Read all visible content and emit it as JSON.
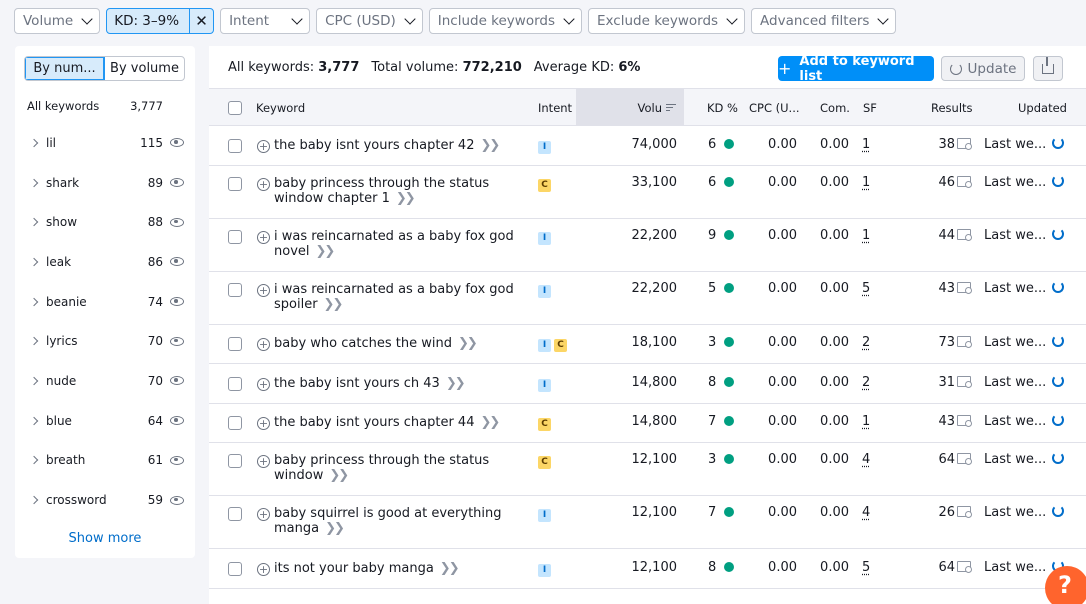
{
  "filters": [
    {
      "label": "Volume"
    },
    {
      "label": "KD: 3–9%",
      "active": true
    },
    {
      "label": "Intent"
    },
    {
      "label": "CPC (USD)"
    },
    {
      "label": "Include keywords"
    },
    {
      "label": "Exclude keywords"
    },
    {
      "label": "Advanced filters"
    }
  ],
  "sidebar": {
    "toggle": [
      "By num...",
      "By volume"
    ],
    "header_label": "All keywords",
    "header_count": "3,777",
    "items": [
      {
        "word": "lil",
        "count": "115"
      },
      {
        "word": "shark",
        "count": "89"
      },
      {
        "word": "show",
        "count": "88"
      },
      {
        "word": "leak",
        "count": "86"
      },
      {
        "word": "beanie",
        "count": "74"
      },
      {
        "word": "lyrics",
        "count": "70"
      },
      {
        "word": "nude",
        "count": "70"
      },
      {
        "word": "blue",
        "count": "64"
      },
      {
        "word": "breath",
        "count": "61"
      },
      {
        "word": "crossword",
        "count": "59"
      }
    ],
    "show_more": "Show more"
  },
  "summary": {
    "all_label": "All keywords:",
    "all_value": "3,777",
    "vol_label": "Total volume:",
    "vol_value": "772,210",
    "kd_label": "Average KD:",
    "kd_value": "6%"
  },
  "buttons": {
    "add": "Add to keyword list",
    "update": "Update"
  },
  "columns": {
    "keyword": "Keyword",
    "intent": "Intent",
    "volume": "Volu",
    "kd": "KD %",
    "cpc": "CPC (U...",
    "com": "Com.",
    "sf": "SF",
    "results": "Results",
    "updated": "Updated"
  },
  "rows": [
    {
      "kw1": "the baby isnt yours chapter 42",
      "kw2": "",
      "intent": [
        "I"
      ],
      "volume": "74,000",
      "kd": "6",
      "cpc": "0.00",
      "com": "0.00",
      "sf": "1",
      "results": "38",
      "updated": "Last we..."
    },
    {
      "kw1": "baby princess through the status",
      "kw2": "window chapter 1",
      "intent": [
        "C"
      ],
      "volume": "33,100",
      "kd": "6",
      "cpc": "0.00",
      "com": "0.00",
      "sf": "1",
      "results": "46",
      "updated": "Last we..."
    },
    {
      "kw1": "i was reincarnated as a baby fox god",
      "kw2": "novel",
      "intent": [
        "I"
      ],
      "volume": "22,200",
      "kd": "9",
      "cpc": "0.00",
      "com": "0.00",
      "sf": "1",
      "results": "44",
      "updated": "Last we..."
    },
    {
      "kw1": "i was reincarnated as a baby fox god",
      "kw2": "spoiler",
      "intent": [
        "I"
      ],
      "volume": "22,200",
      "kd": "5",
      "cpc": "0.00",
      "com": "0.00",
      "sf": "5",
      "results": "43",
      "updated": "Last we..."
    },
    {
      "kw1": "baby who catches the wind",
      "kw2": "",
      "intent": [
        "I",
        "C"
      ],
      "volume": "18,100",
      "kd": "3",
      "cpc": "0.00",
      "com": "0.00",
      "sf": "2",
      "results": "73",
      "updated": "Last we..."
    },
    {
      "kw1": "the baby isnt yours ch 43",
      "kw2": "",
      "intent": [
        "I"
      ],
      "volume": "14,800",
      "kd": "8",
      "cpc": "0.00",
      "com": "0.00",
      "sf": "2",
      "results": "31",
      "updated": "Last we..."
    },
    {
      "kw1": "the baby isnt yours chapter 44",
      "kw2": "",
      "intent": [
        "C"
      ],
      "volume": "14,800",
      "kd": "7",
      "cpc": "0.00",
      "com": "0.00",
      "sf": "1",
      "results": "43",
      "updated": "Last we..."
    },
    {
      "kw1": "baby princess through the status",
      "kw2": "window",
      "intent": [
        "C"
      ],
      "volume": "12,100",
      "kd": "3",
      "cpc": "0.00",
      "com": "0.00",
      "sf": "4",
      "results": "64",
      "updated": "Last we..."
    },
    {
      "kw1": "baby squirrel is good at everything",
      "kw2": "manga",
      "intent": [
        "I"
      ],
      "volume": "12,100",
      "kd": "7",
      "cpc": "0.00",
      "com": "0.00",
      "sf": "4",
      "results": "26",
      "updated": "Last we..."
    },
    {
      "kw1": "its not your baby manga",
      "kw2": "",
      "intent": [
        "I"
      ],
      "volume": "12,100",
      "kd": "8",
      "cpc": "0.00",
      "com": "0.00",
      "sf": "5",
      "results": "64",
      "updated": "Last we..."
    }
  ],
  "help": "?"
}
